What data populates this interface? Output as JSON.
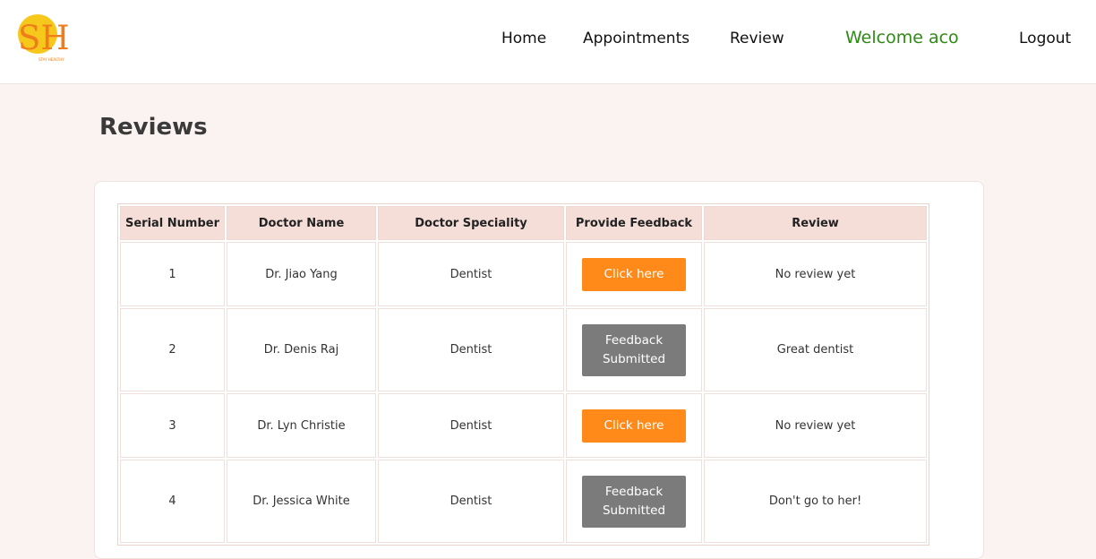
{
  "brand": {
    "logo_text": "SH",
    "logo_tagline": "STAY HEALTHY",
    "colors": {
      "logo_circle": "#f7c81c",
      "logo_letters": "#f07d1c"
    }
  },
  "nav": {
    "links": [
      "Home",
      "Appointments",
      "Review"
    ],
    "welcome": "Welcome aco",
    "logout": "Logout",
    "welcome_color": "#2d8a12"
  },
  "page": {
    "title": "Reviews"
  },
  "table": {
    "headers": [
      "Serial Number",
      "Doctor Name",
      "Doctor Speciality",
      "Provide Feedback",
      "Review"
    ],
    "rows": [
      {
        "serial": "1",
        "doctor": "Dr. Jiao Yang",
        "speciality": "Dentist",
        "feedback_line1": "Click here",
        "feedback_line2": "",
        "feedback_state": "open",
        "review": "No review yet"
      },
      {
        "serial": "2",
        "doctor": "Dr. Denis Raj",
        "speciality": "Dentist",
        "feedback_line1": "Feedback",
        "feedback_line2": "Submitted",
        "feedback_state": "submitted",
        "review": "Great dentist"
      },
      {
        "serial": "3",
        "doctor": "Dr. Lyn Christie",
        "speciality": "Dentist",
        "feedback_line1": "Click here",
        "feedback_line2": "",
        "feedback_state": "open",
        "review": "No review yet"
      },
      {
        "serial": "4",
        "doctor": "Dr. Jessica White",
        "speciality": "Dentist",
        "feedback_line1": "Feedback",
        "feedback_line2": "Submitted",
        "feedback_state": "submitted",
        "review": "Don't go to her!"
      }
    ]
  },
  "colors": {
    "page_bg": "#fbf3f1",
    "header_bg": "#f5ddd8",
    "click_button": "#ff8a1a",
    "submitted_button": "#7b7b7b"
  }
}
